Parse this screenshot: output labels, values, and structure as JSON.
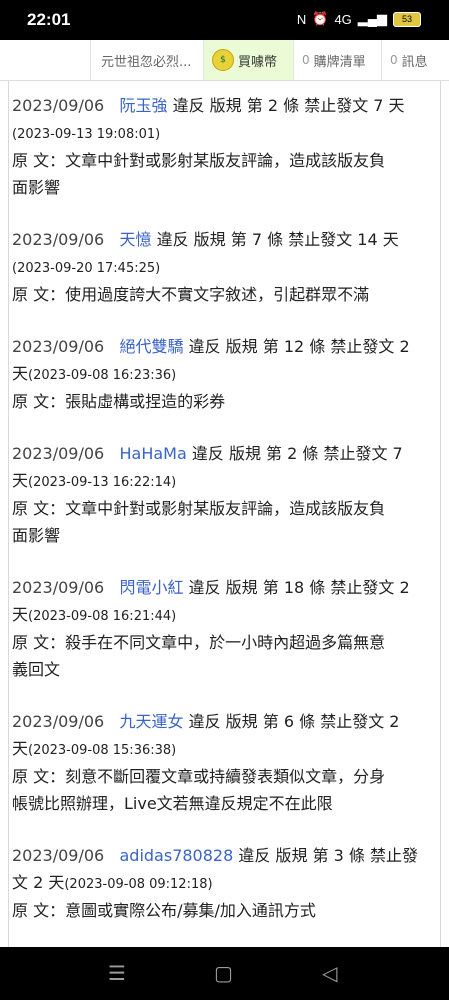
{
  "status_bar": {
    "time": "22:01",
    "network": "4G",
    "battery": "53"
  },
  "tabs": {
    "title": "元世祖忽必烈...",
    "buy": {
      "coin_text": "$",
      "label": "買噱幣"
    },
    "cart": {
      "count": "0",
      "label": "購牌清單"
    },
    "messages": {
      "count": "0",
      "label": "訊息"
    }
  },
  "entries": [
    {
      "date": "2023/09/06",
      "user": "阮玉強",
      "line1_rest": "違反 版規 第 2 條 禁止發文 7 天",
      "line2_pre": "",
      "timestamp": "(2023-09-13 19:08:01)",
      "reason_line1": "原 文：文章中針對或影射某版友評論，造成該版友負",
      "reason_line2": "面影響"
    },
    {
      "date": "2023/09/06",
      "user": "天憶",
      "line1_rest": "違反 版規 第 7 條 禁止發文 14 天",
      "line2_pre": "",
      "timestamp": "(2023-09-20 17:45:25)",
      "reason_line1": "原 文：使用過度誇大不實文字敘述，引起群眾不滿",
      "reason_line2": ""
    },
    {
      "date": "2023/09/06",
      "user": "絕代雙驕",
      "line1_rest": "違反 版規 第 12 條 禁止發文 2",
      "line2_pre": "天",
      "timestamp": "(2023-09-08 16:23:36)",
      "reason_line1": "原 文：張貼虛構或捏造的彩券",
      "reason_line2": ""
    },
    {
      "date": "2023/09/06",
      "user": "HaHaMa",
      "line1_rest": "違反 版規 第 2 條 禁止發文 7",
      "line2_pre": "天",
      "timestamp": "(2023-09-13 16:22:14)",
      "reason_line1": "原 文：文章中針對或影射某版友評論，造成該版友負",
      "reason_line2": "面影響"
    },
    {
      "date": "2023/09/06",
      "user": "閃電小紅",
      "line1_rest": "違反 版規 第 18 條 禁止發文 2",
      "line2_pre": "天",
      "timestamp": "(2023-09-08 16:21:44)",
      "reason_line1": "原 文：殺手在不同文章中，於一小時內超過多篇無意",
      "reason_line2": "義回文"
    },
    {
      "date": "2023/09/06",
      "user": "九天運女",
      "line1_rest": "違反 版規 第 6 條 禁止發文 2",
      "line2_pre": "天",
      "timestamp": "(2023-09-08 15:36:38)",
      "reason_line1": "原 文：刻意不斷回覆文章或持續發表類似文章，分身",
      "reason_line2": "帳號比照辦理，Live文若無違反規定不在此限"
    },
    {
      "date": "2023/09/06",
      "user": "adidas780828",
      "line1_rest": "違反 版規 第 3 條 禁止發",
      "line2_pre": "文 2 天",
      "timestamp": "(2023-09-08 09:12:18)",
      "reason_line1": "原 文：意圖或實際公布/募集/加入通訊方式",
      "reason_line2": ""
    }
  ]
}
